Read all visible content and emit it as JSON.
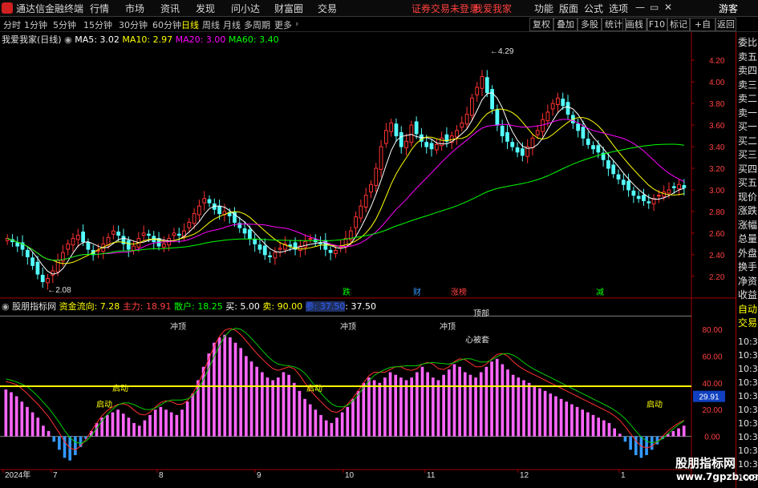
{
  "app": {
    "title": "通达信金融终端",
    "menu": [
      "行情",
      "市场",
      "资讯",
      "发现",
      "问小达",
      "财富圈",
      "交易"
    ],
    "notice": "证券交易未登录",
    "stock_name_top": "我爱我家",
    "right_menu": [
      "功能",
      "版面",
      "公式",
      "选项"
    ],
    "guest": "游客"
  },
  "periods": {
    "items": [
      "分时",
      "1分钟",
      "5分钟",
      "15分钟",
      "30分钟",
      "60分钟",
      "日线",
      "周线",
      "月线",
      "多周期",
      "更多"
    ],
    "active": "日线",
    "tools": [
      "复权",
      "叠加",
      "多股",
      "统计",
      "画线",
      "F10",
      "标记",
      "+自选",
      "返回"
    ]
  },
  "main_info": {
    "stock": "我爱我家(日线)",
    "ma5": "MA5: 3.02",
    "ma10": "MA10: 2.97",
    "ma20": "MA20: 3.00",
    "ma60": "MA60: 3.40"
  },
  "price_axis": [
    "4.20",
    "4.00",
    "3.80",
    "3.60",
    "3.40",
    "3.20",
    "3.00",
    "2.80",
    "2.60",
    "2.40",
    "2.20"
  ],
  "price_marks": {
    "high": "4.29",
    "low": "2.08"
  },
  "event_tags": [
    "跌",
    "财",
    "涨榜",
    "减"
  ],
  "sub_info": {
    "name": "股朋指标网",
    "fund_flow": "资金流向: 7.28",
    "main_force": "主力: 18.91",
    "retail": "散户: 18.25",
    "buy": "买: 5.00",
    "sell": "卖: 90.00",
    "ref": "参: 37.50",
    "ref2": ": 37.50"
  },
  "sub_axis": [
    "80.00",
    "60.00",
    "40.00",
    "20.00",
    "0.00"
  ],
  "sub_current": "29.91",
  "sub_labels": [
    "冲顶",
    "冲顶",
    "冲顶",
    "顶部",
    "心被套",
    "启动",
    "启动",
    "启动",
    "启动"
  ],
  "date_axis": [
    "2024年",
    "7",
    "8",
    "9",
    "10",
    "11",
    "12",
    "1"
  ],
  "side_panel": [
    "委比",
    "卖五",
    "卖四",
    "卖三",
    "卖二",
    "卖一",
    "买一",
    "买二",
    "买三",
    "买四",
    "买五",
    "现价",
    "涨跌",
    "涨幅",
    "总量",
    "外盘",
    "换手",
    "净资",
    "收益",
    "自动",
    "交易"
  ],
  "side_times": [
    "10:3",
    "10:3",
    "10:3",
    "10:3",
    "10:3",
    "10:3",
    "10:3",
    "10:3",
    "10:3",
    "10:3",
    "10:3"
  ],
  "watermark": {
    "line1": "股朋指标网",
    "line2": "www.7gpzb.com"
  },
  "chart_data": {
    "type": "candlestick",
    "price_range": [
      2.05,
      4.35
    ],
    "ma_periods": [
      5,
      10,
      20,
      60
    ],
    "closes": [
      2.55,
      2.52,
      2.48,
      2.45,
      2.38,
      2.3,
      2.22,
      2.15,
      2.18,
      2.25,
      2.35,
      2.42,
      2.5,
      2.55,
      2.58,
      2.52,
      2.45,
      2.4,
      2.44,
      2.5,
      2.56,
      2.62,
      2.58,
      2.5,
      2.45,
      2.48,
      2.55,
      2.6,
      2.58,
      2.52,
      2.48,
      2.5,
      2.55,
      2.6,
      2.58,
      2.62,
      2.7,
      2.78,
      2.85,
      2.92,
      2.88,
      2.82,
      2.78,
      2.8,
      2.76,
      2.7,
      2.65,
      2.6,
      2.55,
      2.5,
      2.45,
      2.4,
      2.38,
      2.42,
      2.46,
      2.5,
      2.48,
      2.45,
      2.48,
      2.52,
      2.55,
      2.52,
      2.5,
      2.45,
      2.42,
      2.44,
      2.48,
      2.55,
      2.62,
      2.75,
      2.85,
      2.95,
      3.05,
      3.2,
      3.4,
      3.55,
      3.62,
      3.5,
      3.4,
      3.45,
      3.6,
      3.52,
      3.45,
      3.4,
      3.38,
      3.42,
      3.48,
      3.45,
      3.5,
      3.55,
      3.62,
      3.7,
      3.85,
      3.95,
      4.05,
      3.9,
      3.75,
      3.6,
      3.5,
      3.45,
      3.4,
      3.35,
      3.32,
      3.4,
      3.48,
      3.55,
      3.65,
      3.72,
      3.8,
      3.85,
      3.78,
      3.7,
      3.62,
      3.55,
      3.48,
      3.42,
      3.38,
      3.35,
      3.28,
      3.2,
      3.15,
      3.1,
      3.05,
      3.0,
      2.95,
      2.92,
      2.9,
      2.88,
      2.92,
      2.95,
      2.98,
      3.0,
      3.02,
      3.05,
      3.02
    ],
    "sub_range": [
      -20,
      92
    ],
    "sub_bars": [
      35,
      33,
      30,
      26,
      22,
      18,
      14,
      8,
      4,
      -4,
      -10,
      -16,
      -18,
      -14,
      -8,
      -2,
      4,
      10,
      14,
      16,
      18,
      20,
      17,
      14,
      10,
      8,
      12,
      16,
      20,
      22,
      20,
      18,
      16,
      20,
      26,
      32,
      42,
      52,
      62,
      70,
      74,
      76,
      74,
      70,
      66,
      60,
      56,
      52,
      48,
      44,
      42,
      44,
      48,
      46,
      40,
      34,
      28,
      24,
      20,
      16,
      12,
      10,
      14,
      18,
      22,
      28,
      34,
      40,
      44,
      42,
      40,
      44,
      48,
      46,
      44,
      42,
      44,
      48,
      52,
      48,
      44,
      42,
      46,
      50,
      54,
      52,
      48,
      46,
      44,
      48,
      52,
      56,
      58,
      54,
      50,
      46,
      44,
      42,
      40,
      38,
      36,
      34,
      32,
      30,
      28,
      26,
      24,
      22,
      20,
      18,
      16,
      14,
      12,
      10,
      6,
      2,
      -4,
      -10,
      -14,
      -16,
      -14,
      -10,
      -6,
      -2,
      2,
      4,
      6,
      8
    ],
    "threshold_line": 37.5
  },
  "colors": {
    "up": "#ff3232",
    "down": "#54ffff",
    "ma5": "#ffffff",
    "ma10": "#ffff00",
    "ma20": "#ff00ff",
    "ma60": "#00ff00",
    "hist_pos": "#ff66ff",
    "hist_neg": "#3399ff"
  }
}
